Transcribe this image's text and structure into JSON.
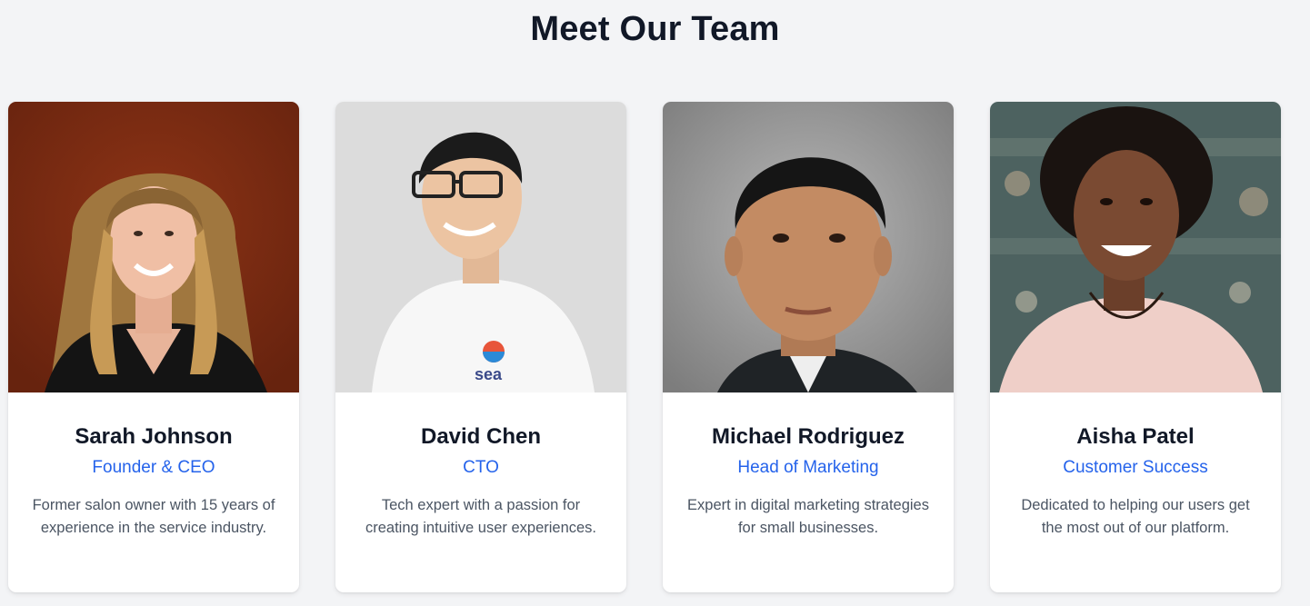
{
  "section": {
    "title": "Meet Our Team"
  },
  "team": [
    {
      "name": "Sarah Johnson",
      "role": "Founder & CEO",
      "bio": "Former salon owner with 15 years of experience in the service industry.",
      "photo_icon": "portrait-photo"
    },
    {
      "name": "David Chen",
      "role": "CTO",
      "bio": "Tech expert with a passion for creating intuitive user experiences.",
      "photo_icon": "portrait-photo",
      "shirt_logo_text": "sea"
    },
    {
      "name": "Michael Rodriguez",
      "role": "Head of Marketing",
      "bio": "Expert in digital marketing strategies for small businesses.",
      "photo_icon": "portrait-photo"
    },
    {
      "name": "Aisha Patel",
      "role": "Customer Success",
      "bio": "Dedicated to helping our users get the most out of our platform.",
      "photo_icon": "portrait-photo"
    }
  ],
  "colors": {
    "background": "#f3f4f6",
    "card": "#ffffff",
    "heading": "#111827",
    "role_accent": "#2563eb",
    "bio_text": "#4b5563"
  }
}
